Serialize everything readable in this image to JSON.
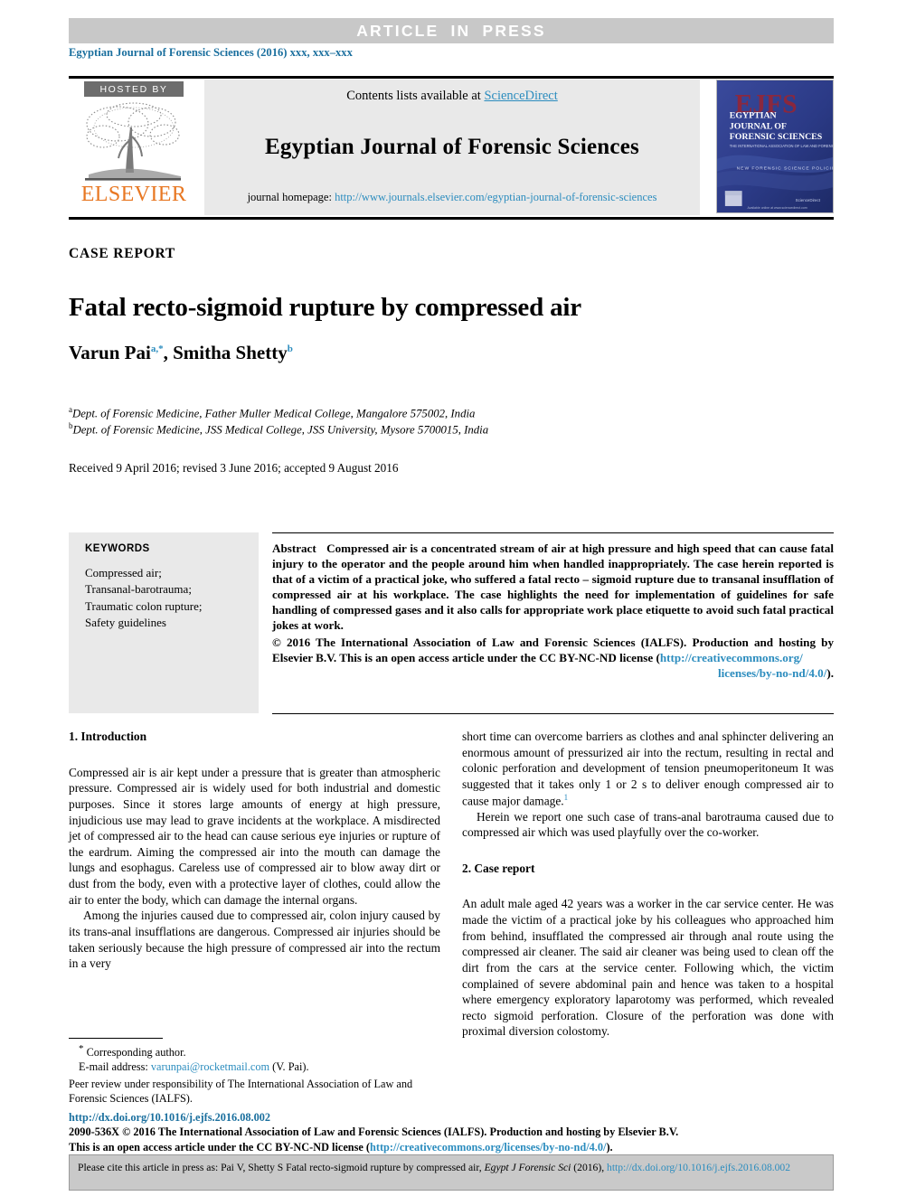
{
  "banner": {
    "text": "ARTICLE IN PRESS"
  },
  "journal_ref": {
    "text": "Egyptian Journal of Forensic Sciences (2016) xxx, xxx–xxx"
  },
  "header": {
    "hosted_by": "HOSTED BY",
    "publisher_logo_text": "ELSEVIER",
    "tree_icon": "elsevier-tree-icon",
    "contents_prefix": "Contents lists available at ",
    "contents_link": "ScienceDirect",
    "journal_title": "Egyptian Journal of Forensic Sciences",
    "homepage_label": "journal homepage: ",
    "homepage_url": "http://www.journals.elsevier.com/egyptian-journal-of-forensic-sciences",
    "cover": {
      "mark": "EJFS",
      "line1": "EGYPTIAN",
      "line2": "JOURNAL OF",
      "line3": "FORENSIC SCIENCES",
      "subtitle": "THE INTERNATIONAL ASSOCIATION OF LAW AND FORENSIC SCIENCES",
      "band": "NEW FORENSIC SCIENCE POLICIES ISSUED",
      "footer_left": "elsevier-logo",
      "footer_right": "ScienceDirect"
    }
  },
  "article": {
    "type_label": "CASE REPORT",
    "title": "Fatal recto-sigmoid rupture by compressed air",
    "authors": [
      {
        "name": "Varun Pai",
        "marks": "a,*"
      },
      {
        "name": "Smitha Shetty",
        "marks": "b"
      }
    ],
    "authors_separator": ", ",
    "affiliations": [
      {
        "mark": "a",
        "text": "Dept. of Forensic Medicine, Father Muller Medical College, Mangalore 575002, India"
      },
      {
        "mark": "b",
        "text": "Dept. of Forensic Medicine, JSS Medical College, JSS University, Mysore 5700015, India"
      }
    ],
    "dates": "Received 9 April 2016; revised 3 June 2016; accepted 9 August 2016"
  },
  "keywords": {
    "heading": "KEYWORDS",
    "items": [
      "Compressed air;",
      "Transanal-barotrauma;",
      "Traumatic colon rupture;",
      "Safety guidelines"
    ]
  },
  "abstract": {
    "label": "Abstract",
    "text": "Compressed air is a concentrated stream of air at high pressure and high speed that can cause fatal injury to the operator and the people around him when handled inappropriately. The case herein reported is that of a victim of a practical joke, who suffered a fatal recto – sigmoid rupture due to transanal insufflation of compressed air at his workplace. The case highlights the need for implementation of guidelines for safe handling of compressed gases and it also calls for appropriate work place etiquette to avoid such fatal practical jokes at work.",
    "copyright_pre": "© 2016 The International Association of Law and Forensic Sciences (IALFS). Production and hosting by Elsevier B.V. This is an open access article under the CC BY-NC-ND license (",
    "license_url_head": "http://creativecommons.org/",
    "license_url_tail": "licenses/by-no-nd/4.0/",
    "copyright_post": ")."
  },
  "body": {
    "left": {
      "section_heading": "1. Introduction",
      "paragraphs": [
        "Compressed air is air kept under a pressure that is greater than atmospheric pressure. Compressed air is widely used for both industrial and domestic purposes. Since it stores large amounts of energy at high pressure, injudicious use may lead to grave incidents at the workplace. A misdirected jet of compressed air to the head can cause serious eye injuries or rupture of the eardrum. Aiming the compressed air into the mouth can damage the lungs and esophagus. Careless use of compressed air to blow away dirt or dust from the body, even with a protective layer of clothes, could allow the air to enter the body, which can damage the internal organs.",
        "Among the injuries caused due to compressed air, colon injury caused by its trans-anal insufflations are dangerous. Compressed air injuries should be taken seriously because the high pressure of compressed air into the rectum in a very"
      ]
    },
    "right": {
      "para_cont": "short time can overcome barriers as clothes and anal sphincter delivering an enormous amount of pressurized air into the rectum, resulting in rectal and colonic perforation and development of tension pneumoperitoneum It was suggested that it takes only 1 or 2 s to deliver enough compressed air to cause major damage.",
      "para_cont_ref": "1",
      "para_herein": "Herein we report one such case of trans-anal barotrauma caused due to compressed air which was used playfully over the co-worker.",
      "section_heading": "2. Case report",
      "case_paragraph": "An adult male aged 42 years was a worker in the car service center. He was made the victim of a practical joke by his colleagues who approached him from behind, insufflated the compressed air through anal route using the compressed air cleaner. The said air cleaner was being used to clean off the dirt from the cars at the service center. Following which, the victim complained of severe abdominal pain and hence was taken to a hospital where emergency exploratory laparotomy was performed, which revealed recto sigmoid perforation. Closure of the perforation was done with proximal diversion colostomy."
    }
  },
  "footnote": {
    "corresponding": "Corresponding author.",
    "email_label": "E-mail address: ",
    "email": "varunpai@rocketmail.com",
    "email_suffix": " (V. Pai).",
    "peer_review": "Peer review under responsibility of The International Association of Law and Forensic Sciences (IALFS)."
  },
  "publisher": {
    "doi": "http://dx.doi.org/10.1016/j.ejfs.2016.08.002",
    "issn_line": "2090-536X © 2016 The International Association of Law and Forensic Sciences (IALFS). Production and hosting by Elsevier B.V.",
    "license_line_pre": "This is an open access article under the CC BY-NC-ND license (",
    "license_url": "http://creativecommons.org/licenses/by-no-nd/4.0/",
    "license_line_post": ")."
  },
  "cite_box": {
    "prefix": "Please cite this article in press as: Pai V, Shetty S Fatal recto-sigmoid rupture by compressed air, ",
    "journal_abbrev": "Egypt J Forensic Sci",
    "year": " (2016), ",
    "doi_head": "http://dx.doi.org/10.1016/j.",
    "doi_tail": "ejfs.2016.08.002"
  },
  "colors": {
    "banner_bg": "#c8c8c8",
    "link_blue": "#2b8cbe",
    "journal_ref_blue": "#1a6f9e",
    "elsevier_orange": "#e87722",
    "header_panel": "#e9e9e9",
    "cover_blue": "#2b3a86",
    "cite_box_bg": "#c9c9c9"
  }
}
